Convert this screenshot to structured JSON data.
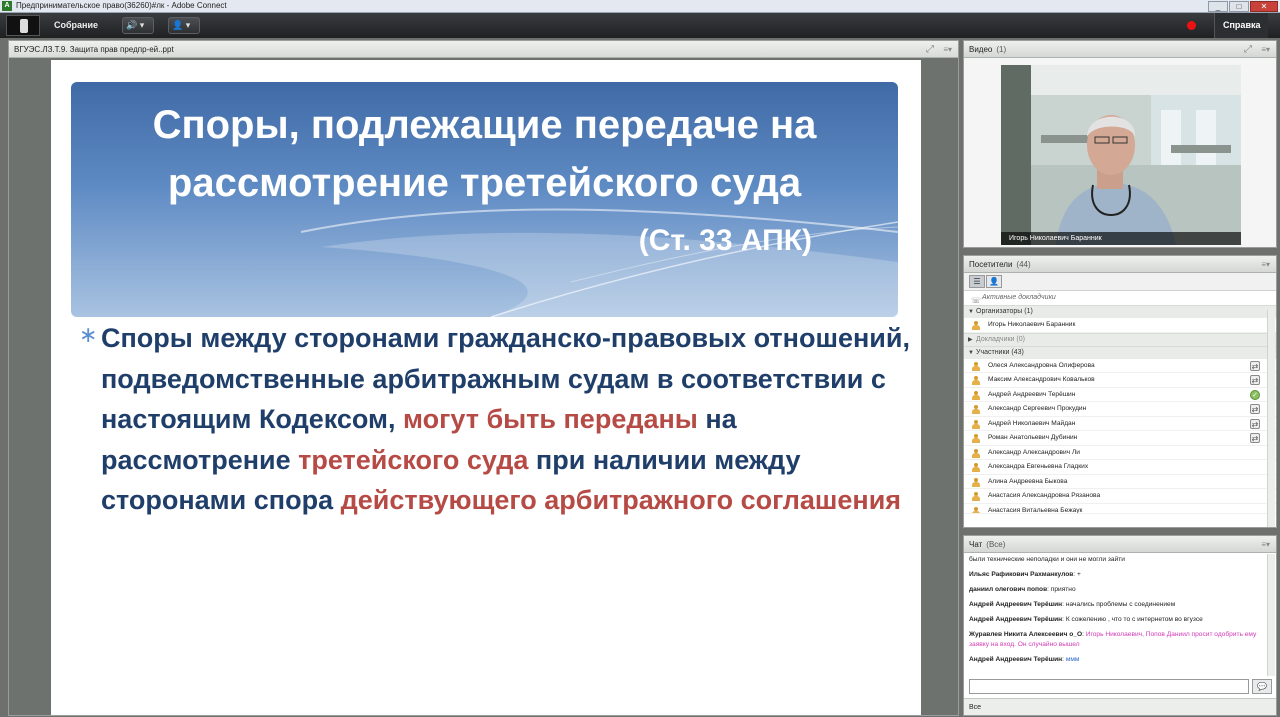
{
  "window": {
    "title": "Предпринимательское право(36260)#лк - Adobe Connect",
    "controls": [
      "_",
      "□",
      "✕"
    ]
  },
  "menubar": {
    "meeting_label": "Собрание",
    "help_label": "Справка",
    "speaker_glyph": "🔊",
    "cam_glyph": "👤"
  },
  "share": {
    "title": "ВГУЭС.ЛЗ.Т.9. Защита прав предпр-ей..ppt",
    "slide": {
      "title_line1": "Споры, подлежащие передаче на",
      "title_line2": "рассмотрение третейского суда",
      "subtitle": "(Ст. 33 АПК)",
      "bullet": "∗",
      "segments": [
        {
          "text": "Споры между сторонами гражданско-правовых отношений, подведомственные арбитражным судам в соответствии с настоящим Кодексом, ",
          "red": false
        },
        {
          "text": "могут быть переданы",
          "red": true
        },
        {
          "text": " на рассмотрение ",
          "red": false
        },
        {
          "text": "третейского суда",
          "red": true
        },
        {
          "text": " при наличии между сторонами спора ",
          "red": false
        },
        {
          "text": "действующего арбитражного соглашения",
          "red": true
        }
      ]
    }
  },
  "video": {
    "title": "Видео",
    "count": "(1)",
    "presenter_name": "Игорь Николаевич Баранник"
  },
  "attendees": {
    "title": "Посетители",
    "count": "(44)",
    "active_speakers_label": "Активные докладчики",
    "groups": {
      "hosts": "Организаторы (1)",
      "presenters": "Докладчики (0)",
      "participants": "Участники (43)"
    },
    "hosts": [
      {
        "name": "Игорь Николаевич Баранник"
      }
    ],
    "participants": [
      {
        "name": "Олеся Александровна Олиферова",
        "status": "away"
      },
      {
        "name": "Максим Александрович Ковальков",
        "status": "away"
      },
      {
        "name": "Андрей Андреевич Терёшин",
        "status": "agree"
      },
      {
        "name": "Александр Сергеевич Прокудин",
        "status": "away"
      },
      {
        "name": "Андрей Николаевич Майдан",
        "status": "away"
      },
      {
        "name": "Роман Анатольевич Дубинин",
        "status": "away"
      },
      {
        "name": "Александр Александрович Ли",
        "status": ""
      },
      {
        "name": "Александра Евгеньевна Гладких",
        "status": ""
      },
      {
        "name": "Алина Андреевна Быкова",
        "status": ""
      },
      {
        "name": "Анастасия Александровна Рязанова",
        "status": ""
      },
      {
        "name": "Анастасия Витальевна Бежаук",
        "status": ""
      }
    ]
  },
  "chat": {
    "title": "Чат",
    "scope": "(Все)",
    "messages": [
      {
        "author": "",
        "text": "были технические неполадки и они не могли зайти",
        "style": "plain"
      },
      {
        "author": "Ильяс Рафикович Рахманкулов",
        "text": "+",
        "style": "plain"
      },
      {
        "author": "даниил олегович попов",
        "text": "приятно",
        "style": "plain"
      },
      {
        "author": "Андрей Андреевич Терёшин",
        "text": "начались проблемы с соединением",
        "style": "plain"
      },
      {
        "author": "Андрей Андреевич Терёшин",
        "text": "К сожелению , что то с интернетом во вгузсе",
        "style": "plain"
      },
      {
        "author": "Журавлев Никита Алексеевич о_О",
        "text": "Игорь Николаевич, Попов Даниил просит одобрить ему заявку на вход. Он случайно вышел",
        "style": "pink"
      },
      {
        "author": "Андрей Андреевич Терёшин",
        "text": "ммм",
        "style": "blue"
      }
    ],
    "footer_scope": "Все"
  }
}
